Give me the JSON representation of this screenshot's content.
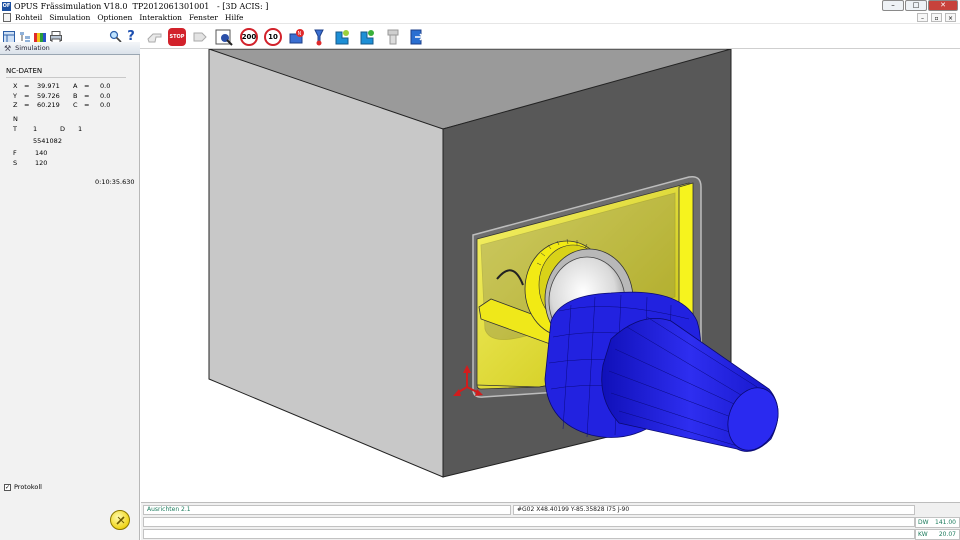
{
  "window": {
    "app_badge": "OF",
    "title": "OPUS Frässimulation V18.0  TP2012061301001   - [3D ACIS: ]",
    "buttons": {
      "minimize": "–",
      "maximize": "□",
      "close": "✕"
    }
  },
  "menu": {
    "items": [
      "Rohteil",
      "Simulation",
      "Optionen",
      "Interaktion",
      "Fenster",
      "Hilfe"
    ],
    "mdi_buttons": [
      "–",
      "▫",
      "×"
    ]
  },
  "toolbar": {
    "stop_label": "STOP",
    "speed_200": "200",
    "speed_10": "10",
    "help_glyph": "?"
  },
  "left_panel": {
    "tab_label": "Simulation",
    "nc_title": "NC-DATEN",
    "x_label": "X",
    "x_value": "39.971",
    "y_label": "Y",
    "y_value": "59.726",
    "z_label": "Z",
    "z_value": "60.219",
    "a_label": "A",
    "a_value": "0.0",
    "b_label": "B",
    "b_value": "0.0",
    "c_label": "C",
    "c_value": "0.0",
    "eq": "=",
    "n_label": "N",
    "t_label": "T",
    "t_value": "1",
    "d_label": "D",
    "d_value": "1",
    "tool_id": "5541082",
    "f_label": "F",
    "f_value": "140",
    "s_label": "S",
    "s_value": "120",
    "time": "0:10:35.630",
    "protokoll_label": "Protokoll",
    "protokoll_checked": true
  },
  "status": {
    "left": "Ausrichten 2.1",
    "nc_line": "#G02 X48.40199 Y-85.35828 I75 J-90",
    "dw_label": "DW",
    "dw_value": "141.00",
    "kw_label": "KW",
    "kw_value": "20.07"
  },
  "colors": {
    "block_front": "#c8c8c8",
    "block_side": "#585858",
    "pocket_yellow": "#f2ee12",
    "tool_blue": "#2222e6",
    "status_text": "#1b7b5c"
  }
}
